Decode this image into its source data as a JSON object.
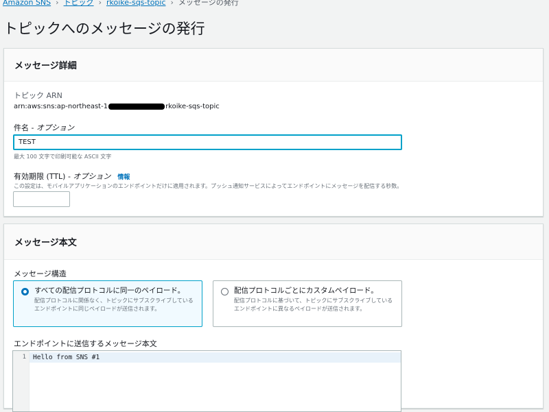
{
  "breadcrumb": {
    "items": [
      "Amazon SNS",
      "トピック",
      "rkoike-sqs-topic"
    ],
    "current": "メッセージの発行"
  },
  "page": {
    "title": "トピックへのメッセージの発行"
  },
  "details": {
    "header": "メッセージ詳細",
    "arn_label": "トピック ARN",
    "arn_prefix": "arn:aws:sns:ap-northeast-1",
    "arn_suffix": "rkoike-sqs-topic",
    "subject_label": "件名 - ",
    "subject_optional": "オプション",
    "subject_value": "TEST",
    "subject_hint": "最大 100 文字で印刷可能な ASCII 文字",
    "ttl_label": "有効期限 (TTL) - ",
    "ttl_optional": "オプション",
    "ttl_info": "情報",
    "ttl_hint": "この設定は、モバイルアプリケーションのエンドポイントだけに適用されます。プッシュ通知サービスによってエンドポイントにメッセージを配信する秒数。",
    "ttl_value": ""
  },
  "body": {
    "header": "メッセージ本文",
    "structure_label": "メッセージ構造",
    "options": [
      {
        "title": "すべての配信プロトコルに同一のペイロード。",
        "desc": "配信プロトコルに関係なく、トピックにサブスクライブしているエンドポイントに同じペイロードが送信されます。",
        "selected": true
      },
      {
        "title": "配信プロトコルごとにカスタムペイロード。",
        "desc": "配信プロトコルに基づいて、トピックにサブスクライブしているエンドポイントに異なるペイロードが送信されます。",
        "selected": false
      }
    ],
    "editor_label": "エンドポイントに送信するメッセージ本文",
    "editor_line_number": "1",
    "editor_content": "Hello from SNS #1"
  },
  "colors": {
    "link": "#0073bb",
    "focus": "#00a1c9",
    "selected_bg": "#f1faff"
  }
}
